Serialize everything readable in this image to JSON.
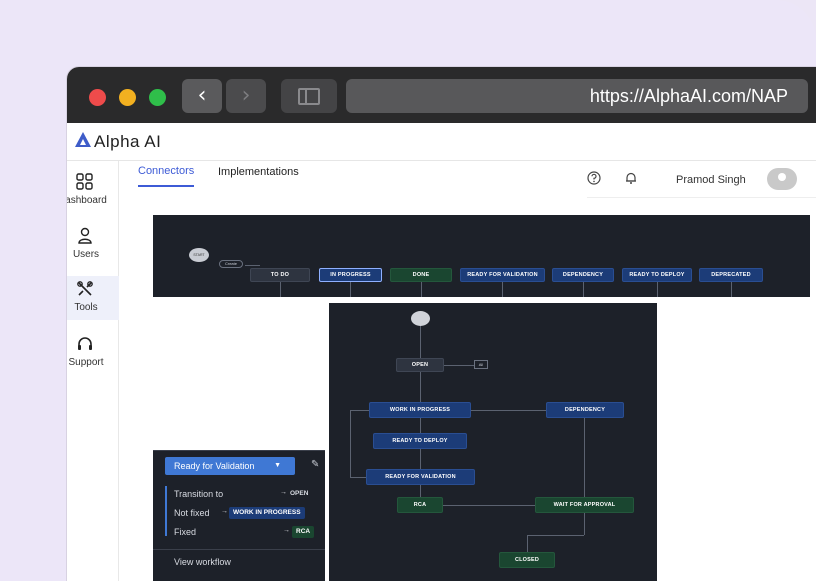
{
  "browser": {
    "url": "https://AlphaAI.com/NAP",
    "back_icon": "chevron-left-icon",
    "forward_icon": "chevron-right-icon"
  },
  "app": {
    "logo_text": "Alpha AI"
  },
  "sidebar": {
    "items": [
      {
        "label": "ashboard",
        "icon": "dashboard-grid-icon"
      },
      {
        "label": "Users",
        "icon": "user-icon"
      },
      {
        "label": "Tools",
        "icon": "tools-icon"
      },
      {
        "label": "Support",
        "icon": "headset-icon"
      }
    ]
  },
  "tabs": [
    {
      "label": "Connectors",
      "active": true
    },
    {
      "label": "Implementations",
      "active": false
    }
  ],
  "header": {
    "user_name": "Pramod Singh"
  },
  "workflow_top": {
    "start_label": "START",
    "create_label": "Create",
    "statuses": [
      "TO DO",
      "IN PROGRESS",
      "DONE",
      "READY FOR VALIDATION",
      "DEPENDENCY",
      "READY TO DEPLOY",
      "DEPRECATED"
    ]
  },
  "workflow_main": {
    "nodes": {
      "open": "OPEN",
      "all": "All",
      "wip": "WORK IN PROGRESS",
      "dependency": "DEPENDENCY",
      "ready_deploy": "READY TO DEPLOY",
      "ready_validation": "READY FOR VALIDATION",
      "rca": "RCA",
      "wait": "WAIT FOR APPROVAL",
      "closed": "CLOSED"
    }
  },
  "transition_panel": {
    "dropdown_label": "Ready for Validation",
    "rows": [
      {
        "label": "Transition to",
        "target": "OPEN"
      },
      {
        "label": "Not fixed",
        "target": "WORK IN PROGRESS"
      },
      {
        "label": "Fixed",
        "target": "RCA"
      }
    ],
    "footer": "View workflow"
  },
  "colors": {
    "accent": "#3d5bd6",
    "panel_bg": "#1d2129",
    "node_blue": "#1c3c78",
    "node_green": "#1a4630"
  }
}
